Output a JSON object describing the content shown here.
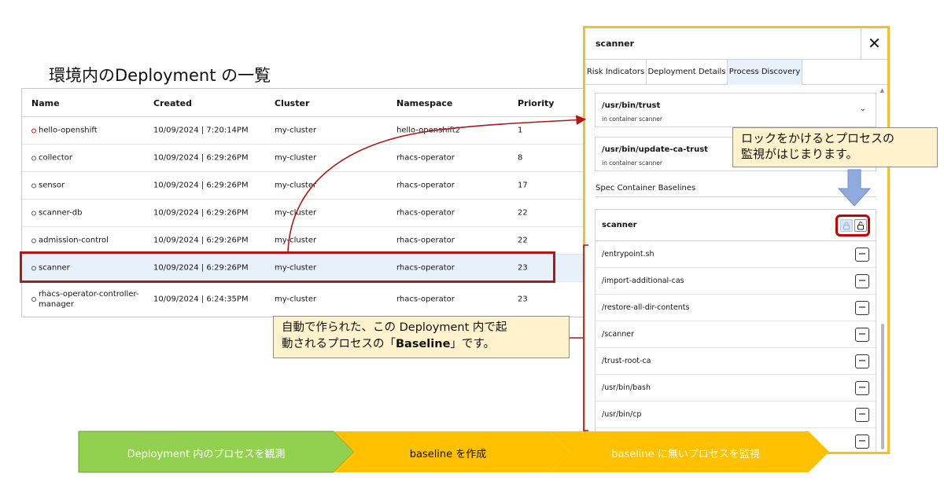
{
  "section_title": "環境内のDeployment の一覧",
  "table": {
    "headers": [
      "Name",
      "Created",
      "Cluster",
      "Namespace",
      "Priority"
    ],
    "rows": [
      {
        "name": "hello-openshift",
        "created": "10/09/2024 | 7:20:14PM",
        "cluster": "my-cluster",
        "namespace": "hello-openshift2",
        "priority": "1"
      },
      {
        "name": "collector",
        "created": "10/09/2024 | 6:29:26PM",
        "cluster": "my-cluster",
        "namespace": "rhacs-operator",
        "priority": "8"
      },
      {
        "name": "sensor",
        "created": "10/09/2024 | 6:29:26PM",
        "cluster": "my-cluster",
        "namespace": "rhacs-operator",
        "priority": "17"
      },
      {
        "name": "scanner-db",
        "created": "10/09/2024 | 6:29:26PM",
        "cluster": "my-cluster",
        "namespace": "rhacs-operator",
        "priority": "22"
      },
      {
        "name": "admission-control",
        "created": "10/09/2024 | 6:29:26PM",
        "cluster": "my-cluster",
        "namespace": "rhacs-operator",
        "priority": "22"
      },
      {
        "name": "scanner",
        "created": "10/09/2024 | 6:29:26PM",
        "cluster": "my-cluster",
        "namespace": "rhacs-operator",
        "priority": "23"
      },
      {
        "name": "rhacs-operator-controller-manager",
        "created": "10/09/2024 | 6:24:35PM",
        "cluster": "my-cluster",
        "namespace": "rhacs-operator",
        "priority": "23"
      }
    ]
  },
  "panel": {
    "title": "scanner",
    "close": "✕",
    "tabs": [
      "Risk Indicators",
      "Deployment Details",
      "Process Discovery"
    ],
    "processes": [
      {
        "path": "/usr/bin/trust",
        "sub": "in container scanner"
      },
      {
        "path": "/usr/bin/update-ca-trust",
        "sub": "in container scanner"
      }
    ],
    "spec_label": "Spec Container Baselines",
    "baseline_name": "scanner",
    "baseline_items": [
      "/entrypoint.sh",
      "/import-additional-cas",
      "/restore-all-dir-contents",
      "/scanner",
      "/trust-root-ca",
      "/usr/bin/bash",
      "/usr/bin/cp",
      ""
    ]
  },
  "callouts": {
    "lock_line1": "ロックをかけるとプロセスの",
    "lock_line2": "監視がはじまります。",
    "base_line1": "自動で作られた、この Deployment 内で起",
    "base_line2_a": "動されるプロセスの「",
    "base_line2_b": "Baseline",
    "base_line2_c": "」です。"
  },
  "flow": {
    "steps": [
      "Deployment 内のプロセスを観測",
      "baseline を作成",
      "baseline に無いプロセスを監視"
    ],
    "colors": [
      "#92d050",
      "#ffc000",
      "#ffc000"
    ]
  },
  "colors": {
    "highlight_red": "#b01717",
    "panel_border": "#f6be2c",
    "selected_row": "#e7f1fa",
    "arrow_blue": "#8faadc"
  }
}
